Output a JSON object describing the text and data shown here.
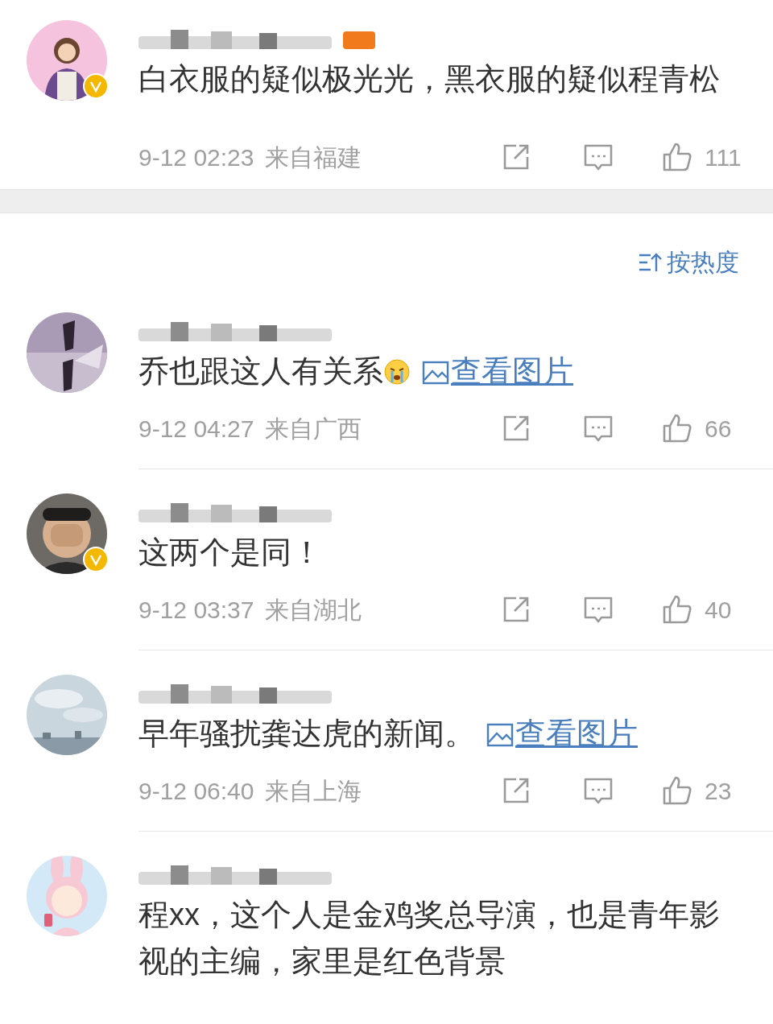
{
  "top_comment": {
    "verified": true,
    "text": "白衣服的疑似极光光，黑衣服的疑似程青松",
    "time": "9-12 02:23",
    "location": "来自福建",
    "likes": "111"
  },
  "sort": {
    "label": "按热度"
  },
  "comments": [
    {
      "verified": false,
      "text": "乔也跟这人有关系",
      "emoji": true,
      "image_link": "查看图片",
      "time": "9-12 04:27",
      "location": "来自广西",
      "likes": "66"
    },
    {
      "verified": true,
      "text": "这两个是同！",
      "emoji": false,
      "time": "9-12 03:37",
      "location": "来自湖北",
      "likes": "40"
    },
    {
      "verified": false,
      "text": "早年骚扰龚达虎的新闻。",
      "emoji": false,
      "image_link": "查看图片",
      "time": "9-12 06:40",
      "location": "来自上海",
      "likes": "23"
    },
    {
      "verified": false,
      "text": "程xx，这个人是金鸡奖总导演，也是青年影视的主编，家里是红色背景",
      "emoji": false
    }
  ]
}
